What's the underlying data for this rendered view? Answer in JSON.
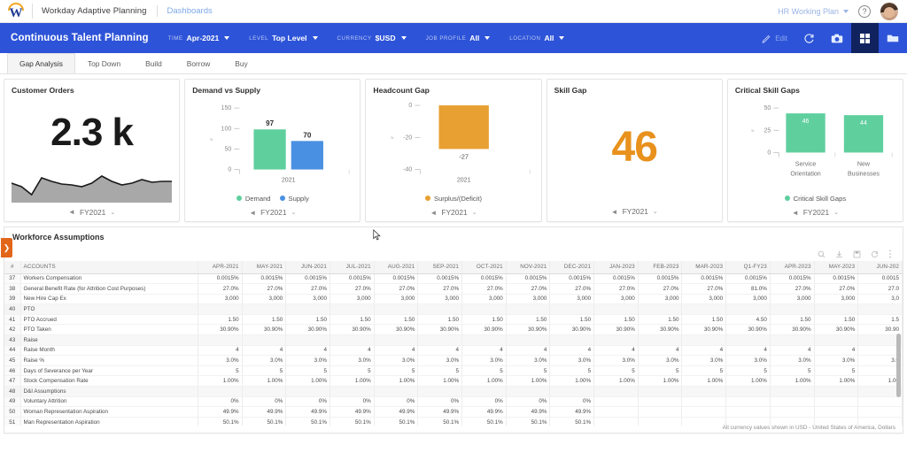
{
  "brand": {
    "logo_name": "workday-logo",
    "product": "Workday Adaptive Planning",
    "dashboards_link": "Dashboards",
    "plan_selector": "HR Working Plan",
    "help_icon": "question-mark-icon",
    "avatar": "user-avatar"
  },
  "appbar": {
    "title": "Continuous Talent Planning",
    "filters": [
      {
        "key": "TIME",
        "value": "Apr-2021"
      },
      {
        "key": "LEVEL",
        "value": "Top Level"
      },
      {
        "key": "CURRENCY",
        "value": "$USD"
      },
      {
        "key": "JOB PROFILE",
        "value": "All"
      },
      {
        "key": "LOCATION",
        "value": "All"
      }
    ],
    "actions": [
      {
        "name": "edit-button",
        "icon": "pencil-icon",
        "label": "Edit",
        "active": false
      },
      {
        "name": "refresh-button",
        "icon": "refresh-icon",
        "label": "",
        "active": false
      },
      {
        "name": "snapshot-button",
        "icon": "camera-icon",
        "label": "",
        "active": false
      },
      {
        "name": "grid-view-button",
        "icon": "grid-icon",
        "label": "",
        "active": true
      },
      {
        "name": "folder-button",
        "icon": "folder-icon",
        "label": "",
        "active": false
      }
    ]
  },
  "tabs": [
    {
      "label": "Gap Analysis",
      "selected": true
    },
    {
      "label": "Top Down",
      "selected": false
    },
    {
      "label": "Build",
      "selected": false
    },
    {
      "label": "Borrow",
      "selected": false
    },
    {
      "label": "Buy",
      "selected": false
    }
  ],
  "cards": [
    {
      "title": "Customer Orders",
      "period": "FY2021"
    },
    {
      "title": "Demand vs Supply",
      "period": "FY2021"
    },
    {
      "title": "Headcount Gap",
      "period": "FY2021"
    },
    {
      "title": "Skill Gap",
      "period": "FY2021"
    },
    {
      "title": "Critical Skill Gaps",
      "period": "FY2021"
    }
  ],
  "chart_data": [
    {
      "type": "area",
      "title": "Customer Orders",
      "big_value": "2.3 k",
      "x": [
        0,
        1,
        2,
        3,
        4,
        5,
        6,
        7,
        8,
        9,
        10,
        11,
        12,
        13,
        14,
        15,
        16
      ],
      "values": [
        62,
        55,
        40,
        72,
        66,
        62,
        60,
        58,
        64,
        74,
        66,
        60,
        63,
        68,
        64,
        66,
        66
      ],
      "ylim": [
        0,
        100
      ],
      "xlabel": "",
      "ylabel": "",
      "grid": false,
      "series_color": "#a8a8a8",
      "line_color": "#1a1a1a"
    },
    {
      "type": "bar",
      "title": "Demand vs Supply",
      "categories": [
        "2021"
      ],
      "series": [
        {
          "name": "Demand",
          "values": [
            97
          ],
          "color": "#5fcf9e"
        },
        {
          "name": "Supply",
          "values": [
            70
          ],
          "color": "#4a90e2"
        }
      ],
      "yticks": [
        0,
        50,
        100,
        150
      ],
      "ylim": [
        0,
        150
      ],
      "xlabel": "2021",
      "ylabel": "",
      "grid": false,
      "legend": "bottom"
    },
    {
      "type": "bar",
      "title": "Headcount Gap",
      "categories": [
        "2021"
      ],
      "series": [
        {
          "name": "Surplus/(Deficit)",
          "values": [
            -27
          ],
          "color": "#e8a033"
        }
      ],
      "yticks": [
        0,
        -20,
        -40
      ],
      "ylim": [
        -40,
        0
      ],
      "data_labels": [
        "-27"
      ],
      "xlabel": "2021",
      "ylabel": "",
      "grid": false,
      "legend": "bottom"
    },
    {
      "type": "table",
      "title": "Skill Gap",
      "big_value": "46",
      "values": [
        46
      ],
      "categories": [
        "Skill Gap"
      ],
      "color": "#e8911c"
    },
    {
      "type": "bar",
      "title": "Critical Skill Gaps",
      "categories": [
        "Service Orientation",
        "New Businesses"
      ],
      "series": [
        {
          "name": "Critical Skill Gaps",
          "values": [
            46,
            44
          ],
          "color": "#5fcf9e"
        }
      ],
      "data_labels": [
        "46",
        "44"
      ],
      "yticks": [
        0,
        25,
        50
      ],
      "ylim": [
        0,
        50
      ],
      "xlabel": "",
      "ylabel": "",
      "grid": false,
      "legend": "bottom"
    }
  ],
  "workforce": {
    "title": "Workforce Assumptions",
    "side_tab_icon": "chevron-right-icon",
    "toolbar_icons": [
      "search-icon",
      "export-icon",
      "save-icon",
      "refresh-icon",
      "more-vertical-icon"
    ],
    "columns": [
      "#",
      "ACCOUNTS",
      "APR-2021",
      "MAY-2021",
      "JUN-2021",
      "JUL-2021",
      "AUG-2021",
      "SEP-2021",
      "OCT-2021",
      "NOV-2021",
      "DEC-2021",
      "JAN-2023",
      "FEB-2023",
      "MAR-2023",
      "Q1-FY23",
      "APR-2023",
      "MAY-2023",
      "JUN-202"
    ],
    "rows": [
      {
        "num": "37",
        "label": "Workers Compensation",
        "indent": 0,
        "expander": "",
        "shaded": false,
        "values": [
          "0.0015%",
          "0.0015%",
          "0.0015%",
          "0.0015%",
          "0.0015%",
          "0.0015%",
          "0.0015%",
          "0.0015%",
          "0.0015%",
          "0.0015%",
          "0.0015%",
          "0.0015%",
          "0.0015%",
          "0.0015%",
          "0.0015%",
          "0.0015"
        ]
      },
      {
        "num": "38",
        "label": "General Benefit Rate (for Attrition Cost Purposes)",
        "indent": 0,
        "expander": "",
        "shaded": false,
        "values": [
          "27.0%",
          "27.0%",
          "27.0%",
          "27.0%",
          "27.0%",
          "27.0%",
          "27.0%",
          "27.0%",
          "27.0%",
          "27.0%",
          "27.0%",
          "27.0%",
          "81.0%",
          "27.0%",
          "27.0%",
          "27.0"
        ]
      },
      {
        "num": "39",
        "label": "New Hire Cap Ex",
        "indent": 0,
        "expander": "",
        "shaded": false,
        "values": [
          "3,000",
          "3,000",
          "3,000",
          "3,000",
          "3,000",
          "3,000",
          "3,000",
          "3,000",
          "3,000",
          "3,000",
          "3,000",
          "3,000",
          "3,000",
          "3,000",
          "3,000",
          "3,0"
        ]
      },
      {
        "num": "40",
        "label": "PTO",
        "indent": 0,
        "expander": "−",
        "shaded": true,
        "values": [
          "",
          "",
          "",
          "",
          "",
          "",
          "",
          "",
          "",
          "",
          "",
          "",
          "",
          "",
          "",
          ""
        ]
      },
      {
        "num": "41",
        "label": "PTO Accrued",
        "indent": 1,
        "expander": "",
        "shaded": false,
        "values": [
          "1.50",
          "1.50",
          "1.50",
          "1.50",
          "1.50",
          "1.50",
          "1.50",
          "1.50",
          "1.50",
          "1.50",
          "1.50",
          "1.50",
          "4.50",
          "1.50",
          "1.50",
          "1.5"
        ]
      },
      {
        "num": "42",
        "label": "PTO Taken",
        "indent": 1,
        "expander": "",
        "shaded": false,
        "values": [
          "30.90%",
          "30.90%",
          "30.90%",
          "30.90%",
          "30.90%",
          "30.90%",
          "30.90%",
          "30.90%",
          "30.90%",
          "30.90%",
          "30.90%",
          "30.90%",
          "30.90%",
          "30.90%",
          "30.90%",
          "30.90"
        ]
      },
      {
        "num": "43",
        "label": "Raise",
        "indent": 0,
        "expander": "−",
        "shaded": true,
        "values": [
          "",
          "",
          "",
          "",
          "",
          "",
          "",
          "",
          "",
          "",
          "",
          "",
          "",
          "",
          "",
          ""
        ]
      },
      {
        "num": "44",
        "label": "Raise Month",
        "indent": 1,
        "expander": "",
        "shaded": false,
        "values": [
          "4",
          "4",
          "4",
          "4",
          "4",
          "4",
          "4",
          "4",
          "4",
          "4",
          "4",
          "4",
          "4",
          "4",
          "4",
          ""
        ]
      },
      {
        "num": "45",
        "label": "Raise %",
        "indent": 1,
        "expander": "",
        "shaded": false,
        "values": [
          "3.0%",
          "3.0%",
          "3.0%",
          "3.0%",
          "3.0%",
          "3.0%",
          "3.0%",
          "3.0%",
          "3.0%",
          "3.0%",
          "3.0%",
          "3.0%",
          "3.0%",
          "3.0%",
          "3.0%",
          "3.0"
        ]
      },
      {
        "num": "46",
        "label": "Days of Severance per Year",
        "indent": 0,
        "expander": "",
        "shaded": false,
        "values": [
          "5",
          "5",
          "5",
          "5",
          "5",
          "5",
          "5",
          "5",
          "5",
          "5",
          "5",
          "5",
          "5",
          "5",
          "5",
          ""
        ]
      },
      {
        "num": "47",
        "label": "Stock Compensation Rate",
        "indent": 0,
        "expander": "",
        "shaded": false,
        "values": [
          "1.00%",
          "1.00%",
          "1.00%",
          "1.00%",
          "1.00%",
          "1.00%",
          "1.00%",
          "1.00%",
          "1.00%",
          "1.00%",
          "1.00%",
          "1.00%",
          "1.00%",
          "1.00%",
          "1.00%",
          "1.00"
        ]
      },
      {
        "num": "48",
        "label": "D&I Assumptions",
        "indent": 0,
        "expander": "−",
        "shaded": true,
        "values": [
          "",
          "",
          "",
          "",
          "",
          "",
          "",
          "",
          "",
          "",
          "",
          "",
          "",
          "",
          "",
          ""
        ]
      },
      {
        "num": "49",
        "label": "Voluntary Attrition",
        "indent": 1,
        "expander": "",
        "shaded": false,
        "values": [
          "0%",
          "0%",
          "0%",
          "0%",
          "0%",
          "0%",
          "0%",
          "0%",
          "0%",
          "",
          "",
          "",
          "",
          "",
          "",
          ""
        ]
      },
      {
        "num": "50",
        "label": "Woman Representation Aspiration",
        "indent": 1,
        "expander": "",
        "shaded": false,
        "values": [
          "49.9%",
          "49.9%",
          "49.9%",
          "49.9%",
          "49.9%",
          "49.9%",
          "49.9%",
          "49.9%",
          "49.9%",
          "",
          "",
          "",
          "",
          "",
          "",
          ""
        ]
      },
      {
        "num": "51",
        "label": "Man Representation Aspiration",
        "indent": 1,
        "expander": "",
        "shaded": false,
        "values": [
          "50.1%",
          "50.1%",
          "50.1%",
          "50.1%",
          "50.1%",
          "50.1%",
          "50.1%",
          "50.1%",
          "50.1%",
          "",
          "",
          "",
          "",
          "",
          "",
          ""
        ]
      }
    ],
    "footer_note": "All currency values shown in USD - United States of America, Dollars"
  }
}
